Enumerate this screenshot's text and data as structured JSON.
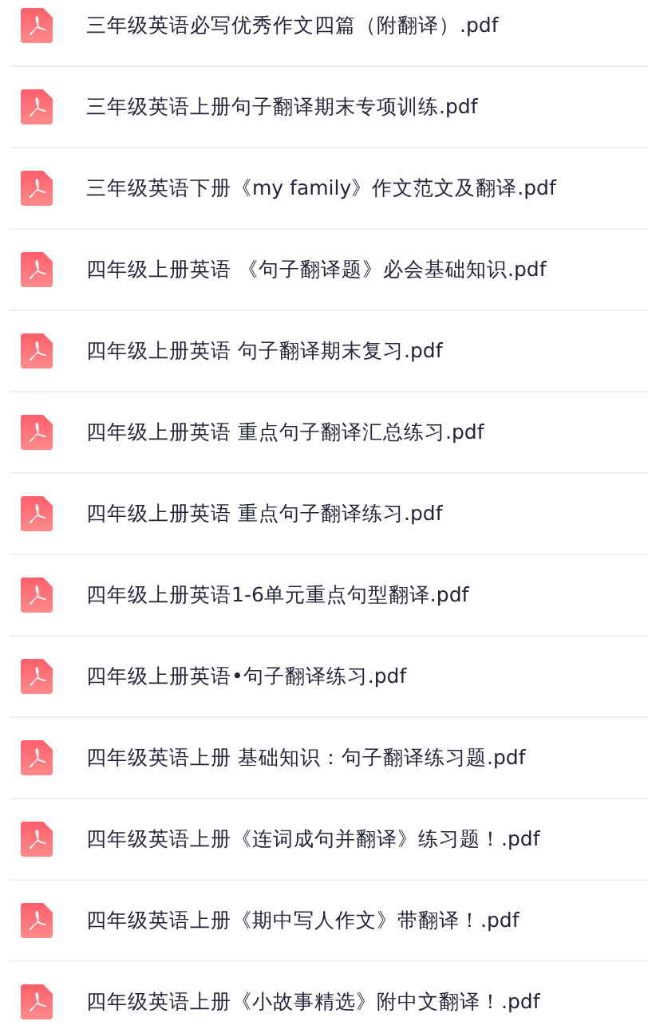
{
  "files": [
    {
      "name": "三年级英语必写优秀作文四篇（附翻译）.pdf"
    },
    {
      "name": "三年级英语上册句子翻译期末专项训练.pdf"
    },
    {
      "name": "三年级英语下册《my family》作文范文及翻译.pdf"
    },
    {
      "name": "四年级上册英语 《句子翻译题》必会基础知识.pdf"
    },
    {
      "name": "四年级上册英语 句子翻译期末复习.pdf"
    },
    {
      "name": "四年级上册英语 重点句子翻译汇总练习.pdf"
    },
    {
      "name": "四年级上册英语 重点句子翻译练习.pdf"
    },
    {
      "name": "四年级上册英语1-6单元重点句型翻译.pdf"
    },
    {
      "name": "四年级上册英语•句子翻译练习.pdf"
    },
    {
      "name": "四年级英语上册 基础知识：句子翻译练习题.pdf"
    },
    {
      "name": "四年级英语上册《连词成句并翻译》练习题！.pdf"
    },
    {
      "name": "四年级英语上册《期中写人作文》带翻译！.pdf"
    },
    {
      "name": "四年级英语上册《小故事精选》附中文翻译！.pdf"
    }
  ]
}
